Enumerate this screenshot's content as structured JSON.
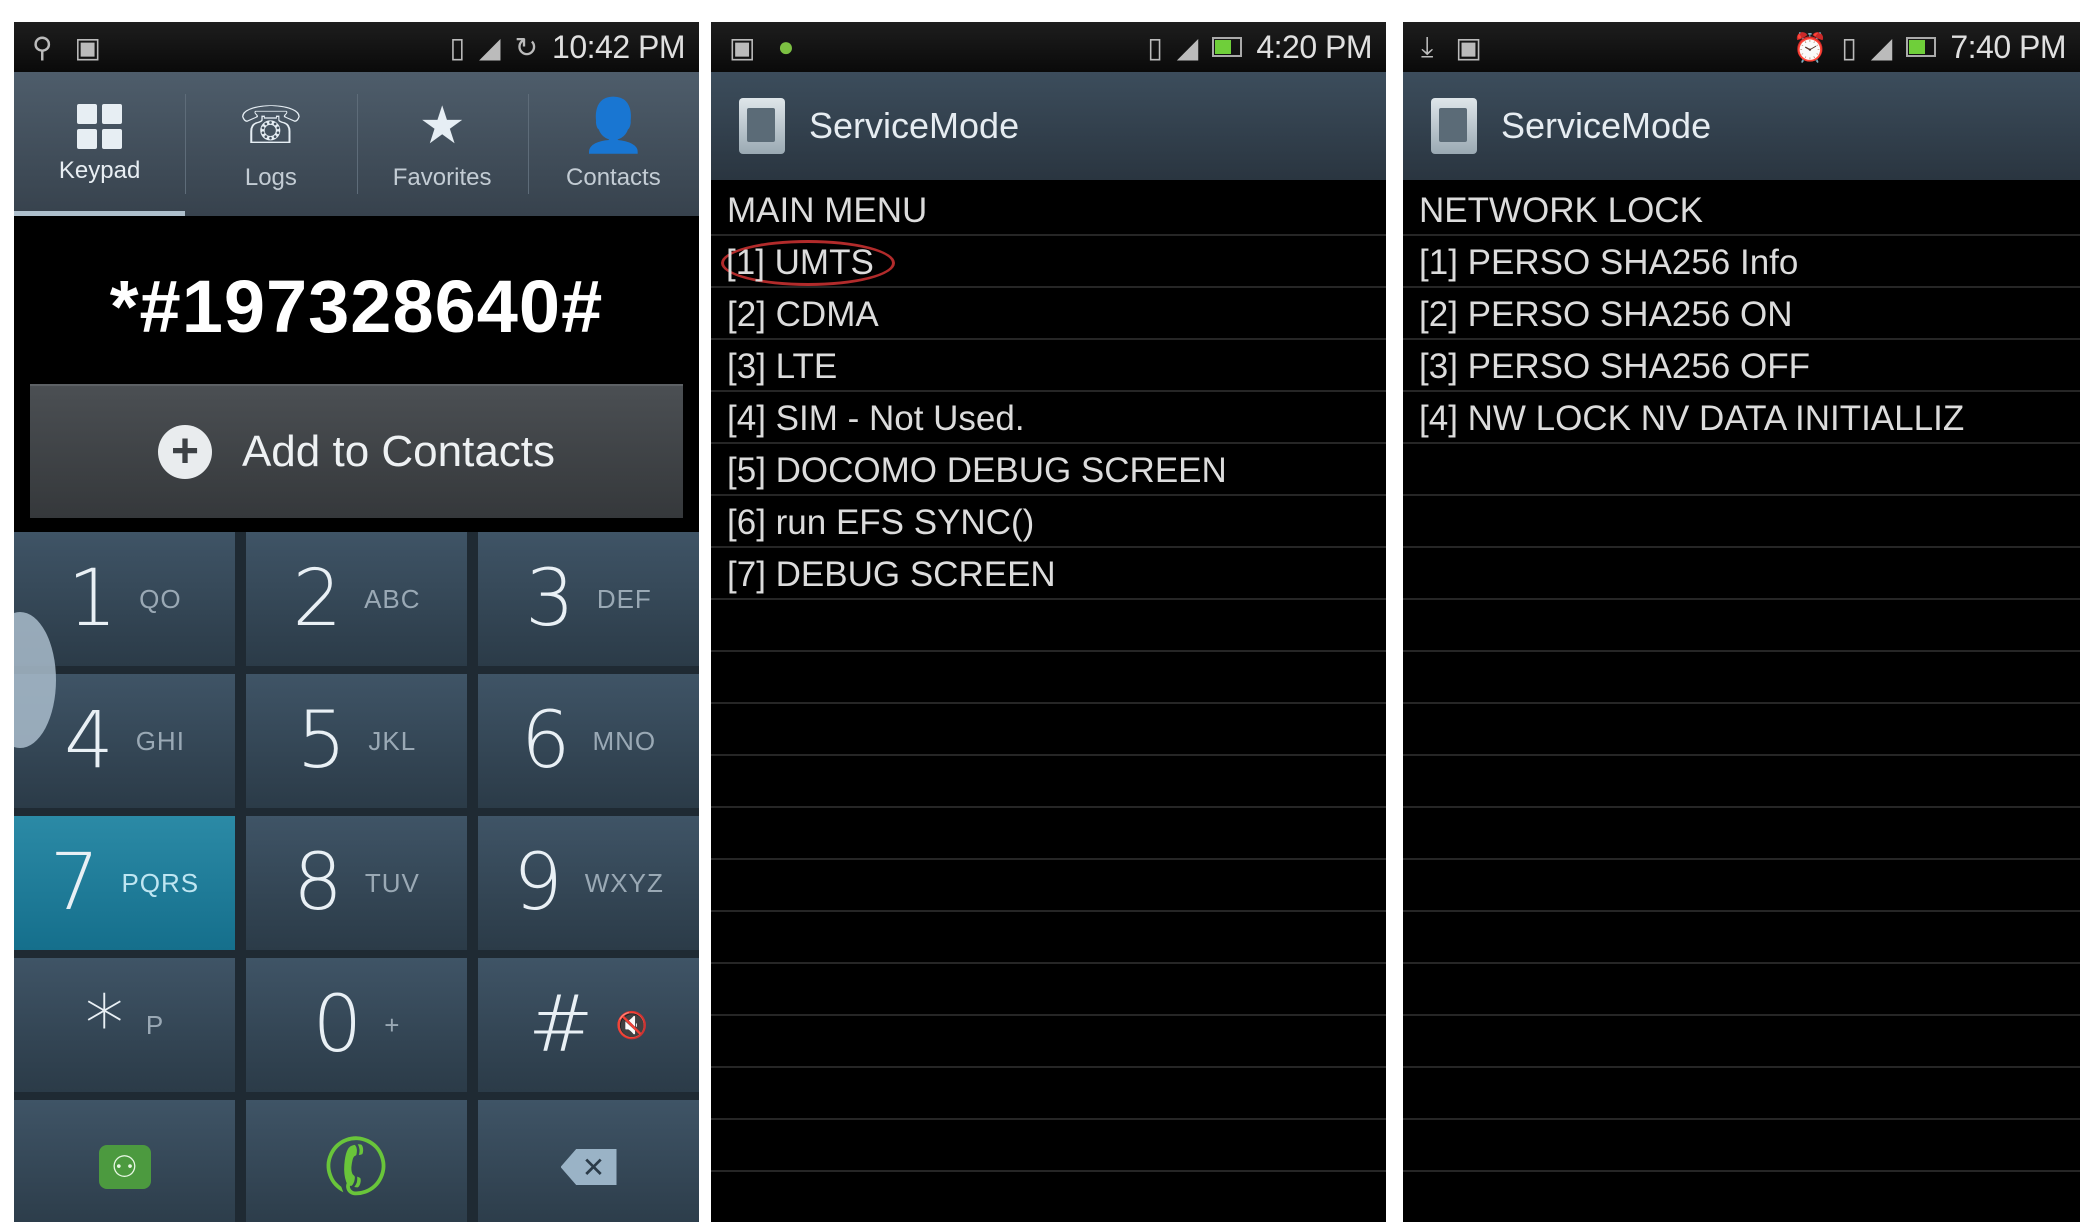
{
  "panel1": {
    "status": {
      "time": "10:42 PM"
    },
    "tabs": [
      {
        "label": "Keypad",
        "icon": "keypad-icon"
      },
      {
        "label": "Logs",
        "icon": "logs-icon"
      },
      {
        "label": "Favorites",
        "icon": "star-icon"
      },
      {
        "label": "Contacts",
        "icon": "person-icon"
      }
    ],
    "dialed_number": "*#197328640#",
    "add_contact_label": "Add to Contacts",
    "keys": [
      {
        "digit": "1",
        "letters": "QO"
      },
      {
        "digit": "2",
        "letters": "ABC"
      },
      {
        "digit": "3",
        "letters": "DEF"
      },
      {
        "digit": "4",
        "letters": "GHI"
      },
      {
        "digit": "5",
        "letters": "JKL"
      },
      {
        "digit": "6",
        "letters": "MNO"
      },
      {
        "digit": "7",
        "letters": "PQRS"
      },
      {
        "digit": "8",
        "letters": "TUV"
      },
      {
        "digit": "9",
        "letters": "WXYZ"
      },
      {
        "digit": "*",
        "letters": "P"
      },
      {
        "digit": "0",
        "letters": "+"
      },
      {
        "digit": "#",
        "letters": ""
      }
    ],
    "highlight_color": "#1a7f9c"
  },
  "panel2": {
    "status": {
      "time": "4:20 PM"
    },
    "title": "ServiceMode",
    "rows": [
      "MAIN MENU",
      "[1] UMTS",
      "[2] CDMA",
      "[3] LTE",
      "[4] SIM - Not Used.",
      "[5] DOCOMO DEBUG SCREEN",
      "[6] run EFS SYNC()",
      "[7] DEBUG SCREEN"
    ],
    "circle_color": "#b22b2b"
  },
  "panel3": {
    "status": {
      "time": "7:40 PM"
    },
    "title": "ServiceMode",
    "rows": [
      "NETWORK LOCK",
      "[1] PERSO SHA256 Info",
      "[2] PERSO SHA256 ON",
      "[3] PERSO SHA256 OFF",
      "[4] NW LOCK NV DATA INITIALLIZ"
    ]
  }
}
